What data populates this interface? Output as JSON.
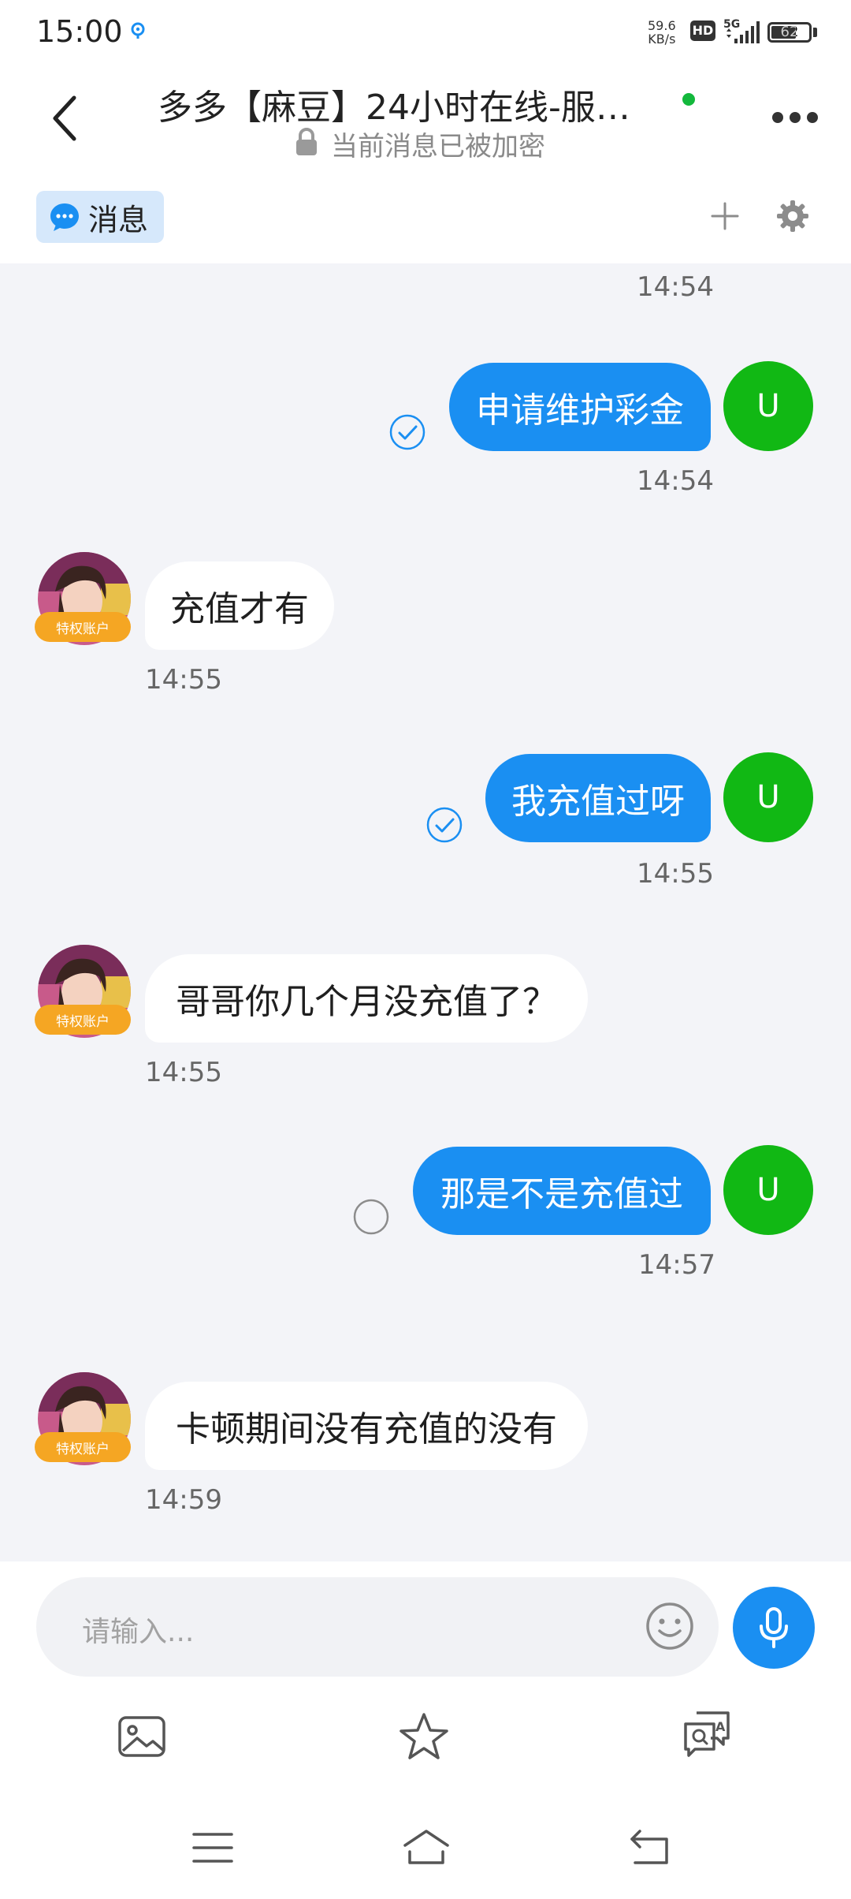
{
  "status_bar": {
    "time": "15:00",
    "net_speed_value": "59.6",
    "net_speed_unit": "KB/s",
    "hd_label": "HD",
    "network": "5G",
    "battery": "62"
  },
  "header": {
    "title": "多多【麻豆】24小时在线-服…",
    "subtitle": "当前消息已被加密",
    "online_color": "#13b83c"
  },
  "tabs": {
    "messages_label": "消息"
  },
  "chat": {
    "top_time": "14:54",
    "messages": [
      {
        "from": "me",
        "text": "申请维护彩金",
        "time": "14:54",
        "avatar": "U",
        "status": "read"
      },
      {
        "from": "other",
        "text": "充值才有",
        "time": "14:55",
        "badge": "特权账户"
      },
      {
        "from": "me",
        "text": "我充值过呀",
        "time": "14:55",
        "avatar": "U",
        "status": "read"
      },
      {
        "from": "other",
        "text": "哥哥你几个月没充值了？",
        "time": "14:55",
        "badge": "特权账户"
      },
      {
        "from": "me",
        "text": "那是不是充值过",
        "time": "14:57",
        "avatar": "U",
        "status": "sent"
      },
      {
        "from": "other",
        "text": "卡顿期间没有充值的没有",
        "time": "14:59",
        "badge": "特权账户"
      }
    ]
  },
  "input": {
    "placeholder": "请输入..."
  },
  "colors": {
    "accent": "#1a8ff2",
    "my_avatar": "#11b814",
    "badge": "#f5a623",
    "chat_bg": "#f3f4f8"
  },
  "icons": {
    "tools": [
      "image-icon",
      "star-icon",
      "quick-reply-icon"
    ],
    "nav": [
      "menu-icon",
      "home-icon",
      "back-nav-icon"
    ]
  }
}
